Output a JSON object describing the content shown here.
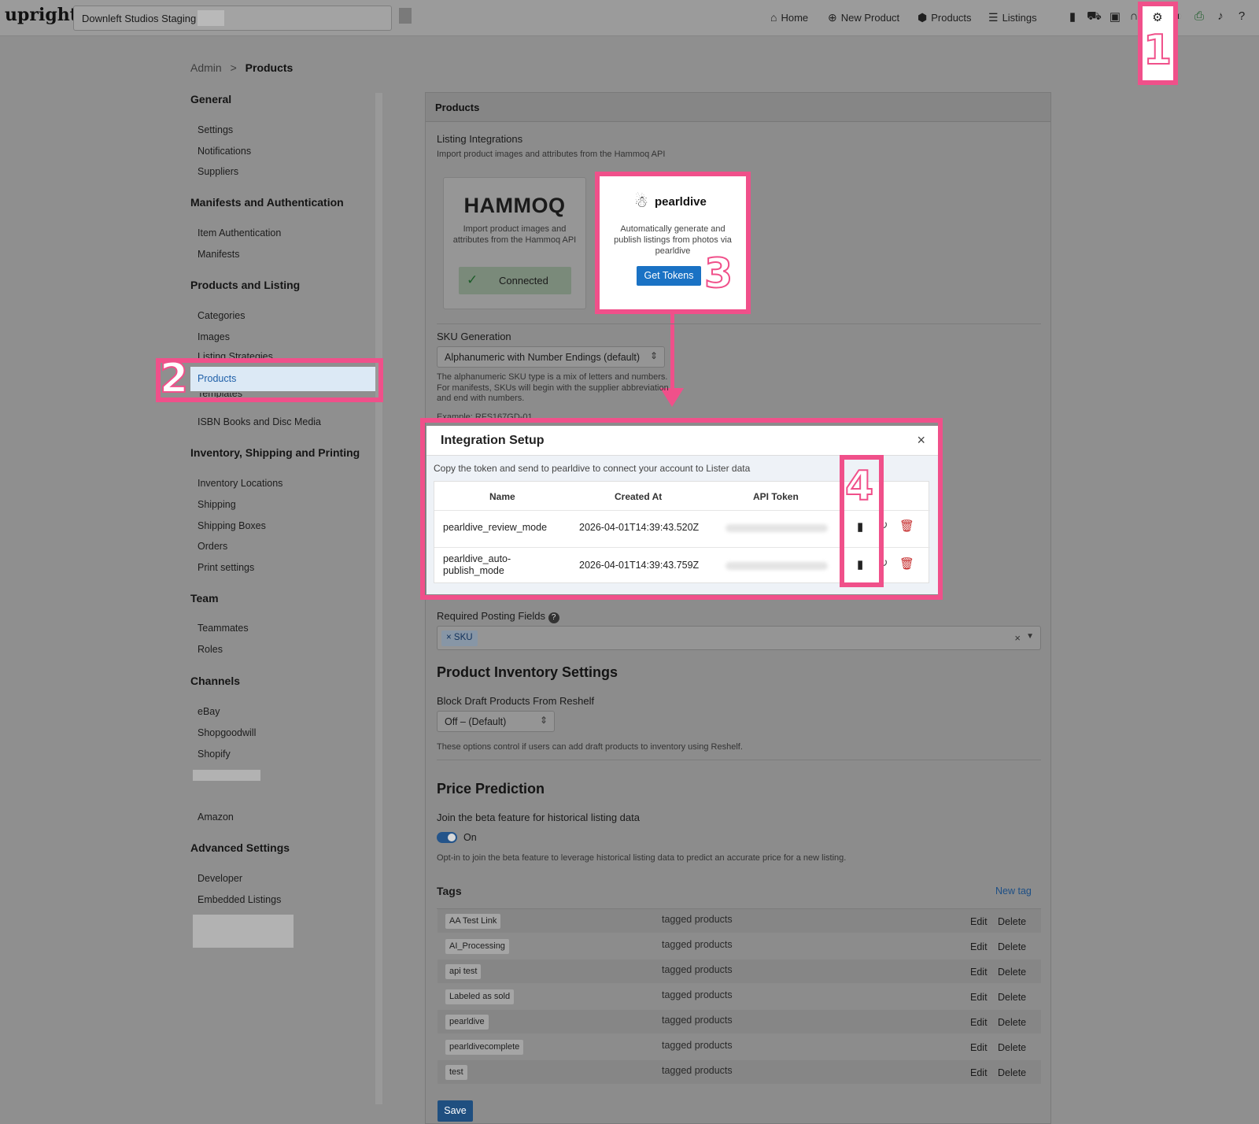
{
  "header": {
    "logo": "upright",
    "store_name": "Downleft Studios Staging",
    "nav": [
      {
        "label": "Home",
        "icon": "home-icon"
      },
      {
        "label": "New Product",
        "icon": "plus-circle-icon"
      },
      {
        "label": "Products",
        "icon": "box-icon"
      },
      {
        "label": "Listings",
        "icon": "list-icon"
      }
    ],
    "tool_icons": [
      "clipboard-icon",
      "cart-icon",
      "inbox-icon",
      "headphones-icon",
      "gear-icon",
      "moon-icon",
      "printer-icon",
      "bell-icon",
      "help-icon"
    ]
  },
  "annotations": {
    "one": "1",
    "two": "2",
    "three": "3",
    "four": "4"
  },
  "breadcrumb": {
    "root": "Admin",
    "separator": ">",
    "current": "Products"
  },
  "sidebar": {
    "general": "General",
    "settings": "Settings",
    "notifications": "Notifications",
    "suppliers": "Suppliers",
    "manifests_auth": "Manifests and Authentication",
    "item_auth": "Item Authentication",
    "manifests": "Manifests",
    "products_listing": "Products and Listing",
    "categories": "Categories",
    "images": "Images",
    "listing_strategies": "Listing Strategies",
    "products": "Products",
    "templates": "Templates",
    "isbn": "ISBN Books and Disc Media",
    "inventory_shipping": "Inventory, Shipping and Printing",
    "inventory_locations": "Inventory Locations",
    "shipping": "Shipping",
    "shipping_boxes": "Shipping Boxes",
    "orders": "Orders",
    "print_settings": "Print settings",
    "team": "Team",
    "teammates": "Teammates",
    "roles": "Roles",
    "channels": "Channels",
    "ebay": "eBay",
    "shopgoodwill": "Shopgoodwill",
    "shopify": "Shopify",
    "amazon": "Amazon",
    "advanced": "Advanced Settings",
    "developer": "Developer",
    "embedded": "Embedded Listings"
  },
  "panel": {
    "title": "Products",
    "listing_integrations": "Listing Integrations",
    "listing_integrations_desc": "Import product images and attributes from the Hammoq API",
    "hammoq": {
      "logo": "HAMMOQ",
      "desc": "Import product images and attributes from the Hammoq API",
      "status": "Connected"
    },
    "pearldive": {
      "logo": "pearldive",
      "desc": "Automatically generate and publish listings from photos via pearldive",
      "button": "Get Tokens"
    },
    "sku_generation": "SKU Generation",
    "sku_select": "Alphanumeric with Number Endings (default)",
    "sku_desc_1": "The alphanumeric SKU type is a mix of letters and numbers.",
    "sku_desc_2": "For manifests, SKUs will begin with the supplier abbreviation",
    "sku_desc_3": "and end with numbers.",
    "sku_example": "Example: RFS167GD-01",
    "required_fields": "Required Posting Fields",
    "required_tag": "SKU",
    "inventory_settings": "Product Inventory Settings",
    "block_draft": "Block Draft Products From Reshelf",
    "block_select": "Off – (Default)",
    "block_desc": "These options control if users can add draft products to inventory using Reshelf.",
    "price_prediction": "Price Prediction",
    "beta_label": "Join the beta feature for historical listing data",
    "toggle_state": "On",
    "beta_desc": "Opt-in to join the beta feature to leverage historical listing data to predict an accurate price for a new listing.",
    "tags_title": "Tags",
    "new_tag": "New tag",
    "tags": [
      {
        "name": "AA Test Link",
        "desc": "tagged products",
        "edit": "Edit",
        "delete": "Delete"
      },
      {
        "name": "AI_Processing",
        "desc": "tagged products",
        "edit": "Edit",
        "delete": "Delete"
      },
      {
        "name": "api test",
        "desc": "tagged products",
        "edit": "Edit",
        "delete": "Delete"
      },
      {
        "name": "Labeled as sold",
        "desc": "tagged products",
        "edit": "Edit",
        "delete": "Delete"
      },
      {
        "name": "pearldive",
        "desc": "tagged products",
        "edit": "Edit",
        "delete": "Delete"
      },
      {
        "name": "pearldivecomplete",
        "desc": "tagged products",
        "edit": "Edit",
        "delete": "Delete"
      },
      {
        "name": "test",
        "desc": "tagged products",
        "edit": "Edit",
        "delete": "Delete"
      }
    ],
    "save": "Save"
  },
  "modal": {
    "title": "Integration Setup",
    "close": "×",
    "desc": "Copy the token and send to pearldive to connect your account to Lister data",
    "columns": [
      "Name",
      "Created At",
      "API Token"
    ],
    "rows": [
      {
        "name": "pearldive_review_mode",
        "created": "2026-04-01T14:39:43.520Z"
      },
      {
        "name": "pearldive_auto-publish_mode",
        "name_line1": "pearldive_auto-",
        "name_line2": "publish_mode",
        "created": "2026-04-01T14:39:43.759Z"
      }
    ]
  }
}
